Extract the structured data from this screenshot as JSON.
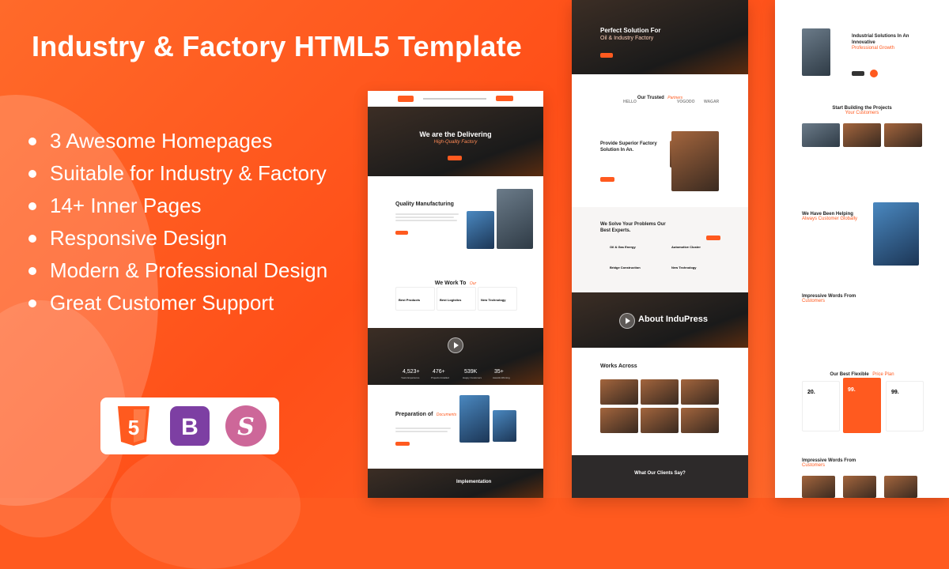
{
  "title": "Industry & Factory HTML5 Template",
  "features": [
    "3 Awesome Homepages",
    "Suitable for Industry & Factory",
    "14+ Inner Pages",
    "Responsive Design",
    "Modern & Professional Design",
    "Great Customer Support"
  ],
  "badges": {
    "html": "5",
    "bootstrap": "B",
    "sass": "S"
  },
  "mockups": {
    "home1": {
      "hero_title": "We are the Delivering",
      "hero_sub": "High-Quality Factory",
      "quality_title": "Quality Manufacturing",
      "work_title": "We Work To",
      "work_accent": "Our",
      "services": [
        "Best Products",
        "Best Logistics",
        "New Technology"
      ],
      "stats": [
        {
          "value": "4,523+",
          "label": "Years Experience"
        },
        {
          "value": "476+",
          "label": "Projects Installed"
        },
        {
          "value": "539K",
          "label": "Happy Customers"
        },
        {
          "value": "35+",
          "label": "Awards Winning"
        }
      ],
      "prep_title": "Preparation of",
      "prep_accent": "Documents",
      "impl_title": "Implementation"
    },
    "home2": {
      "hero_title": "Perfect Solution For",
      "hero_sub": "Oil & Industry Factory",
      "partners_label": "Our Trusted",
      "partners_accent": "Partners",
      "partners": [
        "HELLO",
        "VOGODO",
        "WAGAR"
      ],
      "provide_title": "Provide Superior Factory Solution In An.",
      "solve_title": "We Solve Your Problems Our Best Experts.",
      "solve_items": [
        "Oil & Gas Energy",
        "Automotive Cluster",
        "Bridge Construction",
        "New Technology"
      ],
      "about_label": "About InduPress",
      "works_title": "Works Across",
      "clients_title": "What Our Clients Say?"
    },
    "home3": {
      "about_title": "Industrial Solutions In An Innovative",
      "about_accent": "Professional Growth",
      "start_title": "Start Building the Projects",
      "start_accent": "Your Customers",
      "helping_title": "We Have Been Helping",
      "helping_accent": "Always Customer Globally",
      "words_title": "Impressive Words From",
      "words_accent": "Customers",
      "price_title": "Our Best Flexible",
      "price_accent": "Price Plan",
      "prices": [
        "20.",
        "99.",
        "99."
      ]
    }
  },
  "colors": {
    "accent": "#ff5a1f",
    "dark": "#2d2a2a"
  }
}
